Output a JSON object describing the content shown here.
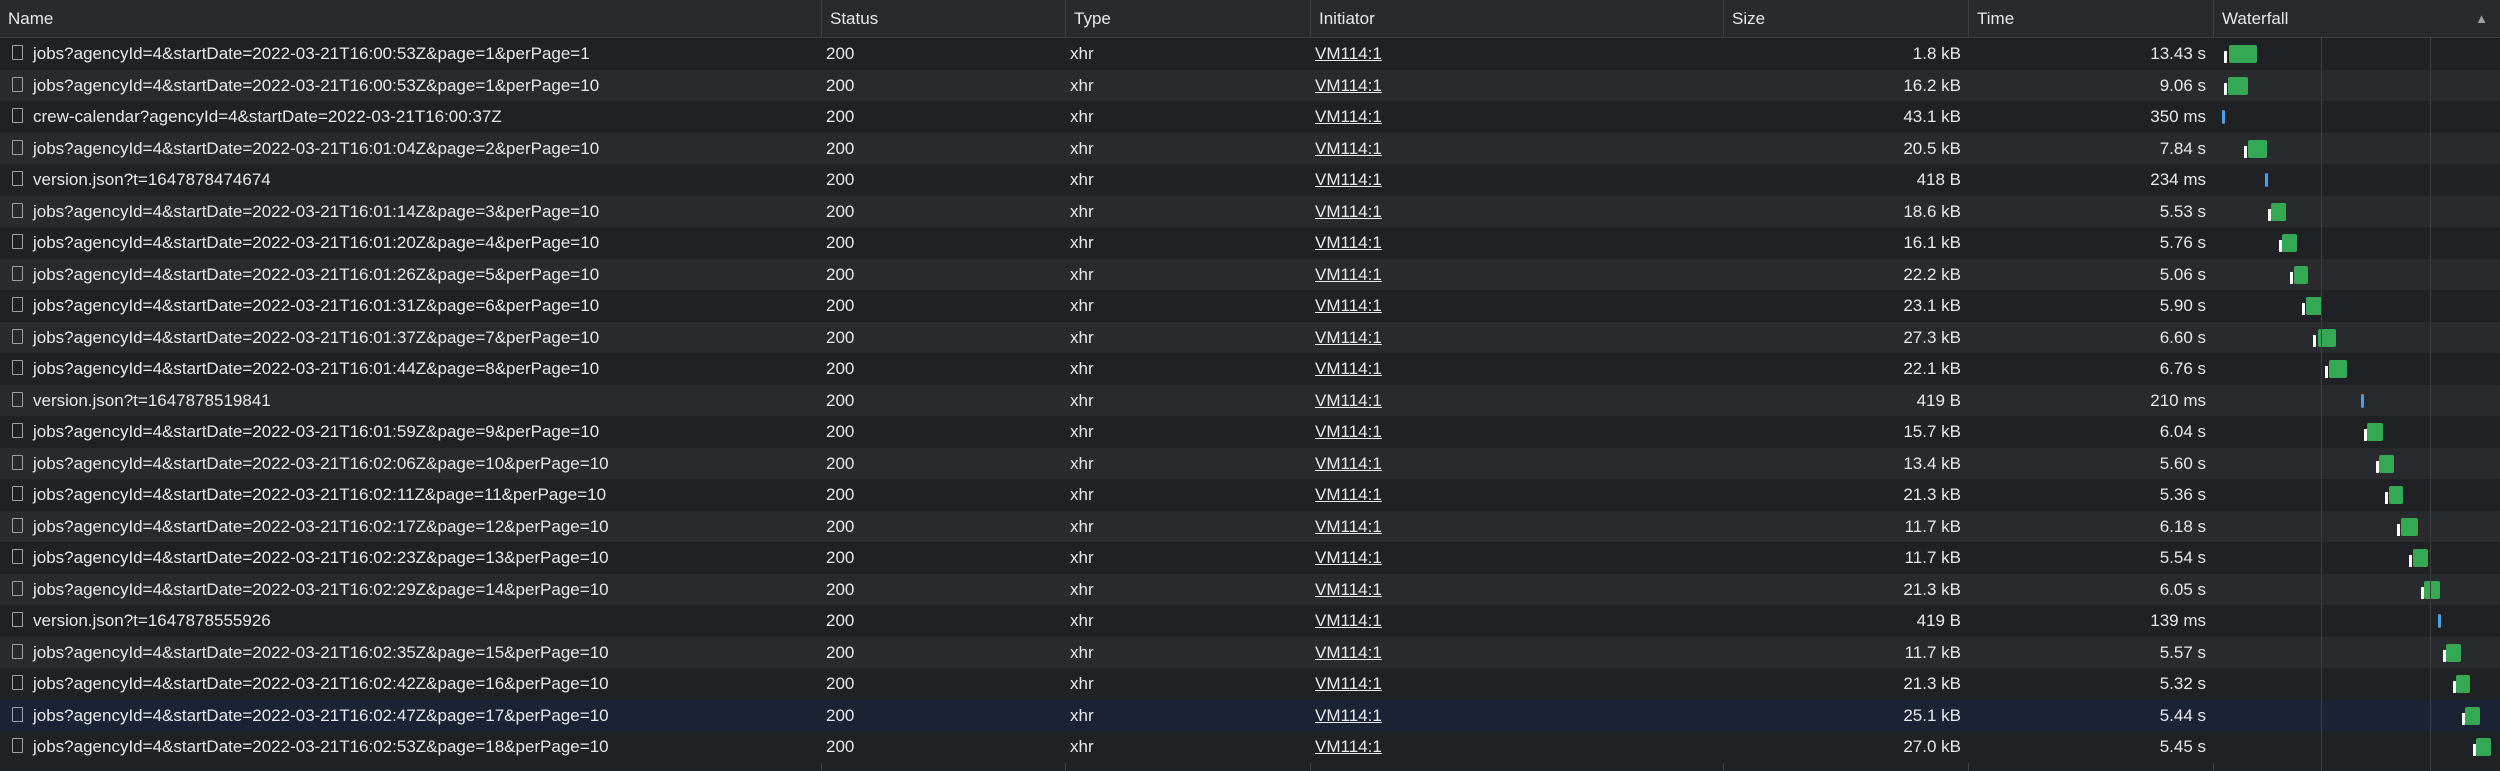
{
  "columns": {
    "name": "Name",
    "status": "Status",
    "type": "Type",
    "initiator": "Initiator",
    "size": "Size",
    "time": "Time",
    "waterfall": "Waterfall"
  },
  "rows": [
    {
      "name": "jobs?agencyId=4&startDate=2022-03-21T16:00:53Z&page=1&perPage=1",
      "status": "200",
      "type": "xhr",
      "initiator": "VM114:1",
      "size": "1.8 kB",
      "time": "13.43 s"
    },
    {
      "name": "jobs?agencyId=4&startDate=2022-03-21T16:00:53Z&page=1&perPage=10",
      "status": "200",
      "type": "xhr",
      "initiator": "VM114:1",
      "size": "16.2 kB",
      "time": "9.06 s"
    },
    {
      "name": "crew-calendar?agencyId=4&startDate=2022-03-21T16:00:37Z",
      "status": "200",
      "type": "xhr",
      "initiator": "VM114:1",
      "size": "43.1 kB",
      "time": "350 ms"
    },
    {
      "name": "jobs?agencyId=4&startDate=2022-03-21T16:01:04Z&page=2&perPage=10",
      "status": "200",
      "type": "xhr",
      "initiator": "VM114:1",
      "size": "20.5 kB",
      "time": "7.84 s"
    },
    {
      "name": "version.json?t=1647878474674",
      "status": "200",
      "type": "xhr",
      "initiator": "VM114:1",
      "size": "418 B",
      "time": "234 ms"
    },
    {
      "name": "jobs?agencyId=4&startDate=2022-03-21T16:01:14Z&page=3&perPage=10",
      "status": "200",
      "type": "xhr",
      "initiator": "VM114:1",
      "size": "18.6 kB",
      "time": "5.53 s"
    },
    {
      "name": "jobs?agencyId=4&startDate=2022-03-21T16:01:20Z&page=4&perPage=10",
      "status": "200",
      "type": "xhr",
      "initiator": "VM114:1",
      "size": "16.1 kB",
      "time": "5.76 s"
    },
    {
      "name": "jobs?agencyId=4&startDate=2022-03-21T16:01:26Z&page=5&perPage=10",
      "status": "200",
      "type": "xhr",
      "initiator": "VM114:1",
      "size": "22.2 kB",
      "time": "5.06 s"
    },
    {
      "name": "jobs?agencyId=4&startDate=2022-03-21T16:01:31Z&page=6&perPage=10",
      "status": "200",
      "type": "xhr",
      "initiator": "VM114:1",
      "size": "23.1 kB",
      "time": "5.90 s"
    },
    {
      "name": "jobs?agencyId=4&startDate=2022-03-21T16:01:37Z&page=7&perPage=10",
      "status": "200",
      "type": "xhr",
      "initiator": "VM114:1",
      "size": "27.3 kB",
      "time": "6.60 s"
    },
    {
      "name": "jobs?agencyId=4&startDate=2022-03-21T16:01:44Z&page=8&perPage=10",
      "status": "200",
      "type": "xhr",
      "initiator": "VM114:1",
      "size": "22.1 kB",
      "time": "6.76 s"
    },
    {
      "name": "version.json?t=1647878519841",
      "status": "200",
      "type": "xhr",
      "initiator": "VM114:1",
      "size": "419 B",
      "time": "210 ms"
    },
    {
      "name": "jobs?agencyId=4&startDate=2022-03-21T16:01:59Z&page=9&perPage=10",
      "status": "200",
      "type": "xhr",
      "initiator": "VM114:1",
      "size": "15.7 kB",
      "time": "6.04 s"
    },
    {
      "name": "jobs?agencyId=4&startDate=2022-03-21T16:02:06Z&page=10&perPage=10",
      "status": "200",
      "type": "xhr",
      "initiator": "VM114:1",
      "size": "13.4 kB",
      "time": "5.60 s"
    },
    {
      "name": "jobs?agencyId=4&startDate=2022-03-21T16:02:11Z&page=11&perPage=10",
      "status": "200",
      "type": "xhr",
      "initiator": "VM114:1",
      "size": "21.3 kB",
      "time": "5.36 s"
    },
    {
      "name": "jobs?agencyId=4&startDate=2022-03-21T16:02:17Z&page=12&perPage=10",
      "status": "200",
      "type": "xhr",
      "initiator": "VM114:1",
      "size": "11.7 kB",
      "time": "6.18 s"
    },
    {
      "name": "jobs?agencyId=4&startDate=2022-03-21T16:02:23Z&page=13&perPage=10",
      "status": "200",
      "type": "xhr",
      "initiator": "VM114:1",
      "size": "11.7 kB",
      "time": "5.54 s"
    },
    {
      "name": "jobs?agencyId=4&startDate=2022-03-21T16:02:29Z&page=14&perPage=10",
      "status": "200",
      "type": "xhr",
      "initiator": "VM114:1",
      "size": "21.3 kB",
      "time": "6.05 s"
    },
    {
      "name": "version.json?t=1647878555926",
      "status": "200",
      "type": "xhr",
      "initiator": "VM114:1",
      "size": "419 B",
      "time": "139 ms"
    },
    {
      "name": "jobs?agencyId=4&startDate=2022-03-21T16:02:35Z&page=15&perPage=10",
      "status": "200",
      "type": "xhr",
      "initiator": "VM114:1",
      "size": "11.7 kB",
      "time": "5.57 s"
    },
    {
      "name": "jobs?agencyId=4&startDate=2022-03-21T16:02:42Z&page=16&perPage=10",
      "status": "200",
      "type": "xhr",
      "initiator": "VM114:1",
      "size": "21.3 kB",
      "time": "5.32 s"
    },
    {
      "name": "jobs?agencyId=4&startDate=2022-03-21T16:02:47Z&page=17&perPage=10",
      "status": "200",
      "type": "xhr",
      "initiator": "VM114:1",
      "size": "25.1 kB",
      "time": "5.44 s"
    },
    {
      "name": "jobs?agencyId=4&startDate=2022-03-21T16:02:53Z&page=18&perPage=10",
      "status": "200",
      "type": "xhr",
      "initiator": "VM114:1",
      "size": "27.0 kB",
      "time": "5.45 s"
    }
  ],
  "selected_row": 21,
  "colors": {
    "background": "#202124",
    "row_alt": "#292a2d",
    "selected": "#1a2333",
    "download_bar": "#35a853",
    "short_bar": "#4d9ee8"
  }
}
